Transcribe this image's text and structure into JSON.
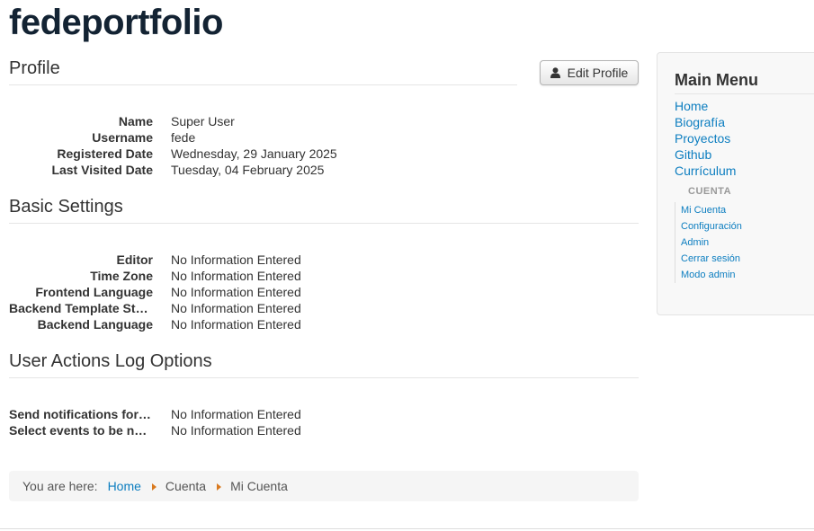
{
  "site": {
    "title": "fedeportfolio"
  },
  "profile": {
    "heading": "Profile",
    "edit_button": "Edit Profile",
    "fields": [
      {
        "label": "Name",
        "value": "Super User"
      },
      {
        "label": "Username",
        "value": "fede"
      },
      {
        "label": "Registered Date",
        "value": "Wednesday, 29 January 2025"
      },
      {
        "label": "Last Visited Date",
        "value": "Tuesday, 04 February 2025"
      }
    ]
  },
  "basic_settings": {
    "heading": "Basic Settings",
    "fields": [
      {
        "label": "Editor",
        "value": "No Information Entered"
      },
      {
        "label": "Time Zone",
        "value": "No Information Entered"
      },
      {
        "label": "Frontend Language",
        "value": "No Information Entered"
      },
      {
        "label": "Backend Template Style",
        "value": "No Information Entered"
      },
      {
        "label": "Backend Language",
        "value": "No Information Entered"
      }
    ]
  },
  "log_options": {
    "heading": "User Actions Log Options",
    "fields": [
      {
        "label": "Send notifications for U…",
        "value": "No Information Entered"
      },
      {
        "label": "Select events to be noti…",
        "value": "No Information Entered"
      }
    ]
  },
  "breadcrumb": {
    "label": "You are here:",
    "items": [
      "Home",
      "Cuenta",
      "Mi Cuenta"
    ]
  },
  "sidebar": {
    "title": "Main Menu",
    "items": [
      "Home",
      "Biografía",
      "Proyectos",
      "Github",
      "Currículum"
    ],
    "sub_header": "CUENTA",
    "sub_items": [
      "Mi Cuenta",
      "Configuración",
      "Admin",
      "Cerrar sesión",
      "Modo admin"
    ]
  },
  "colors": {
    "title": "#132333",
    "link": "#0d7ec0",
    "breadcrumb_divider": "#d9791e"
  },
  "icons": {
    "edit_button": "user-icon"
  }
}
